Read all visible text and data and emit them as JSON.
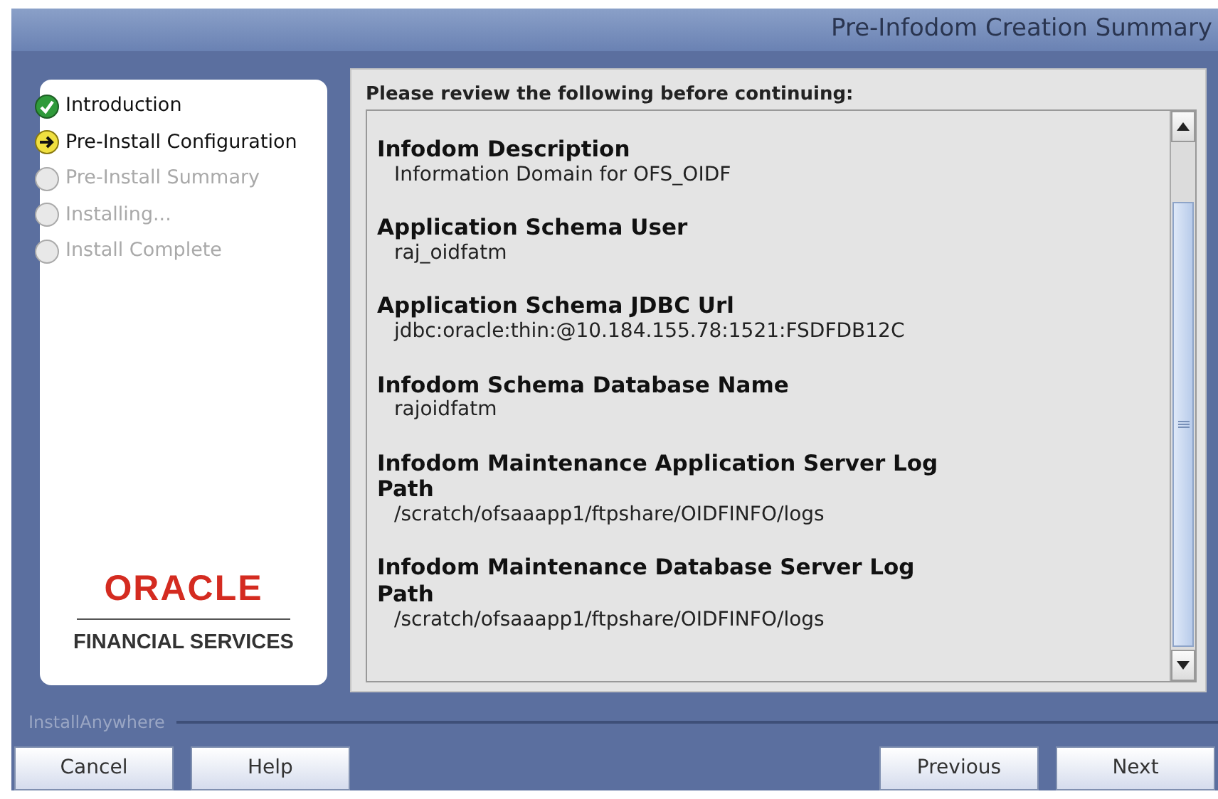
{
  "window": {
    "title": "Pre-Infodom Creation Summary"
  },
  "steps": [
    {
      "label": "Introduction",
      "kind": "done"
    },
    {
      "label": "Pre-Install Configuration",
      "kind": "current"
    },
    {
      "label": "Pre-Install Summary",
      "kind": "pending"
    },
    {
      "label": "Installing...",
      "kind": "pending"
    },
    {
      "label": "Install Complete",
      "kind": "pending"
    }
  ],
  "logo": {
    "brand": "ORACLE",
    "subtitle": "FINANCIAL SERVICES"
  },
  "summary": {
    "heading": "Please review the following before continuing:",
    "entries": [
      {
        "label": "Infodom Description",
        "value": "Information Domain for OFS_OIDF"
      },
      {
        "label": "Application Schema User",
        "value": "raj_oidfatm"
      },
      {
        "label": "Application Schema JDBC Url",
        "value": "jdbc:oracle:thin:@10.184.155.78:1521:FSDFDB12C"
      },
      {
        "label": "Infodom Schema Database Name",
        "value": "rajoidfatm"
      },
      {
        "label": "Infodom Maintenance Application Server Log Path",
        "value": "/scratch/ofsaaapp1/ftpshare/OIDFINFO/logs"
      },
      {
        "label": "Infodom Maintenance Database Server Log Path",
        "value": "/scratch/ofsaaapp1/ftpshare/OIDFINFO/logs"
      }
    ]
  },
  "footer": {
    "vendor": "InstallAnywhere"
  },
  "buttons_left": [
    "Cancel",
    "Help"
  ],
  "buttons_right": [
    "Previous",
    "Next"
  ]
}
